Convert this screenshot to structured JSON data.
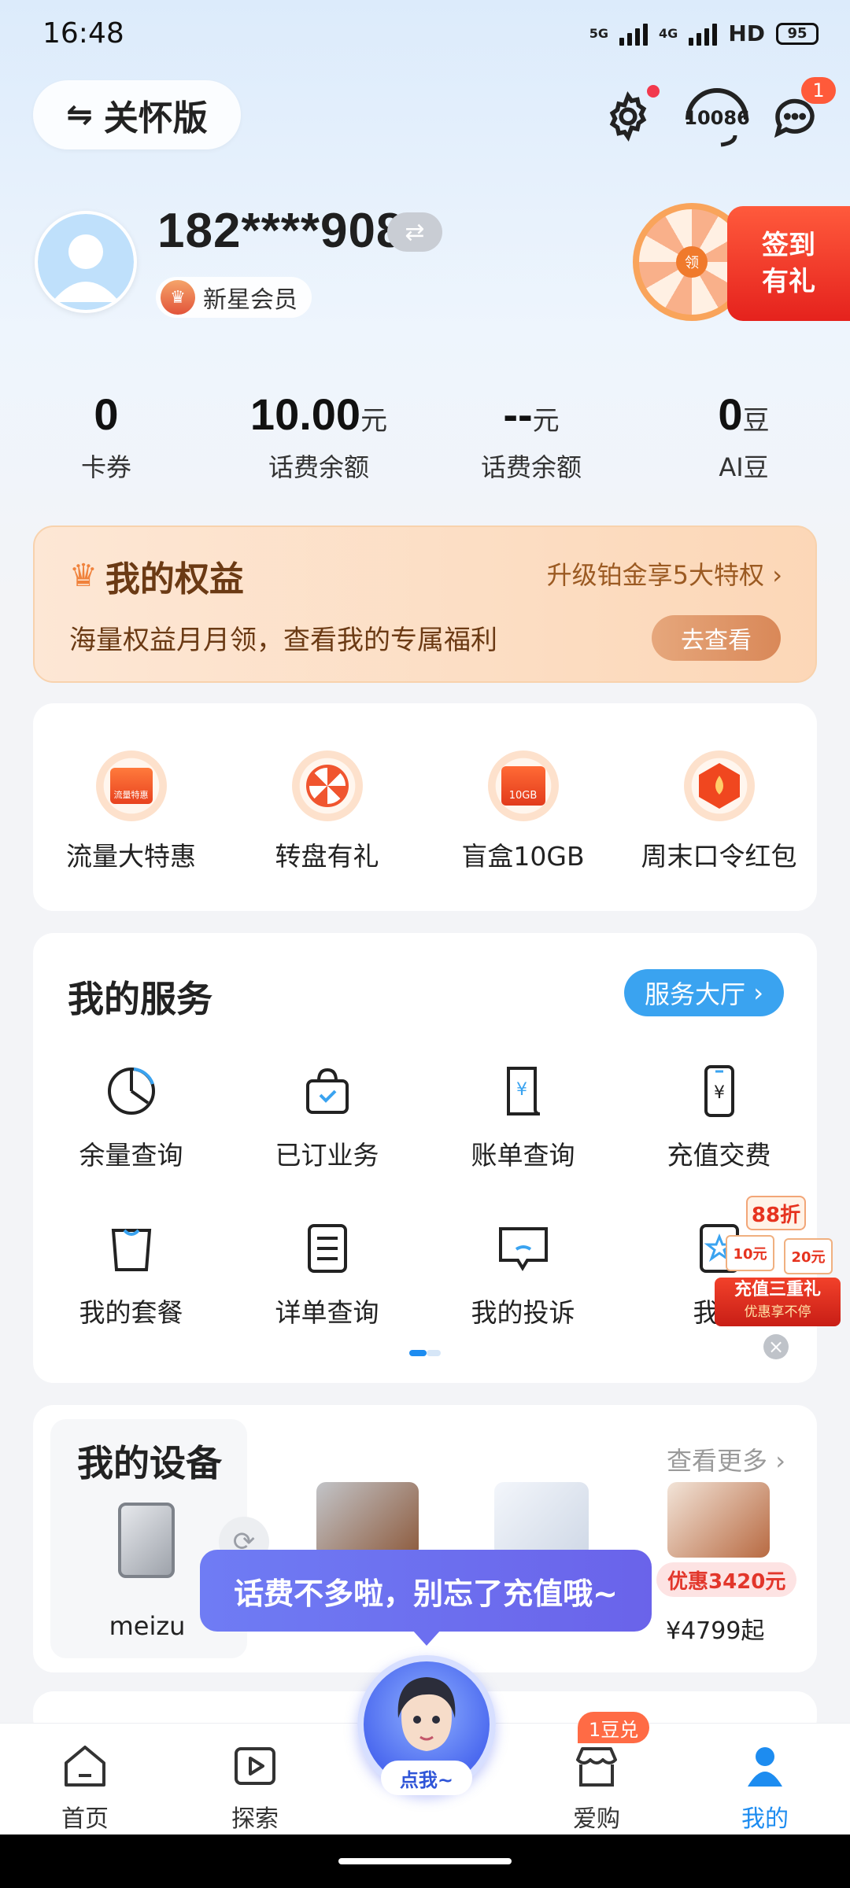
{
  "status_bar": {
    "time": "16:48",
    "network_1": "5G",
    "network_2": "4G",
    "hd": "HD",
    "battery": "95"
  },
  "header": {
    "care_mode": "关怀版",
    "hotline": "10086",
    "message_badge": "1"
  },
  "profile": {
    "phone": "182****9080",
    "member_level": "新星会员"
  },
  "checkin": {
    "wheel_label": "领",
    "line1": "签到",
    "line2": "有礼"
  },
  "stats": [
    {
      "value": "0",
      "unit": "",
      "label": "卡券"
    },
    {
      "value": "10.00",
      "unit": "元",
      "label": "话费余额"
    },
    {
      "value": "--",
      "unit": "元",
      "label": "话费余额"
    },
    {
      "value": "0",
      "unit": "豆",
      "label": "AI豆"
    }
  ],
  "rights": {
    "title": "我的权益",
    "upgrade": "升级铂金享5大特权",
    "desc": "海量权益月月领，查看我的专属福利",
    "button": "去查看"
  },
  "promos": [
    {
      "label": "流量大特惠",
      "icon_text": "流量特惠"
    },
    {
      "label": "转盘有礼",
      "icon_text": ""
    },
    {
      "label": "盲盒10GB",
      "icon_text": "10GB"
    },
    {
      "label": "周末口令红包",
      "icon_text": ""
    }
  ],
  "services": {
    "title": "我的服务",
    "hall_button": "服务大厅",
    "items": [
      {
        "label": "余量查询"
      },
      {
        "label": "已订业务"
      },
      {
        "label": "账单查询"
      },
      {
        "label": "充值交费"
      },
      {
        "label": "我的套餐"
      },
      {
        "label": "详单查询"
      },
      {
        "label": "我的投诉"
      },
      {
        "label": "我的"
      }
    ]
  },
  "float_ad": {
    "discount": "88折",
    "coupon_1": "10元",
    "coupon_2": "20元",
    "line1": "充值三重礼",
    "line2": "优惠享不停"
  },
  "devices": {
    "title": "我的设备",
    "more": "查看更多",
    "my_device": "meizu",
    "promo_tag": "优惠3420元",
    "price": "¥4799起"
  },
  "tooltip": "话费不多啦，别忘了充值哦~",
  "assistant_button": "点我~",
  "nav": {
    "items": [
      {
        "label": "首页"
      },
      {
        "label": "探索"
      },
      {
        "label": "爱购"
      },
      {
        "label": "我的"
      }
    ],
    "shop_badge": "1豆兑"
  },
  "colors": {
    "accent_blue": "#3aa3f0",
    "active_nav": "#1d8cf0",
    "assistant": "#6a63ea",
    "rights_text": "#6b3a14"
  }
}
